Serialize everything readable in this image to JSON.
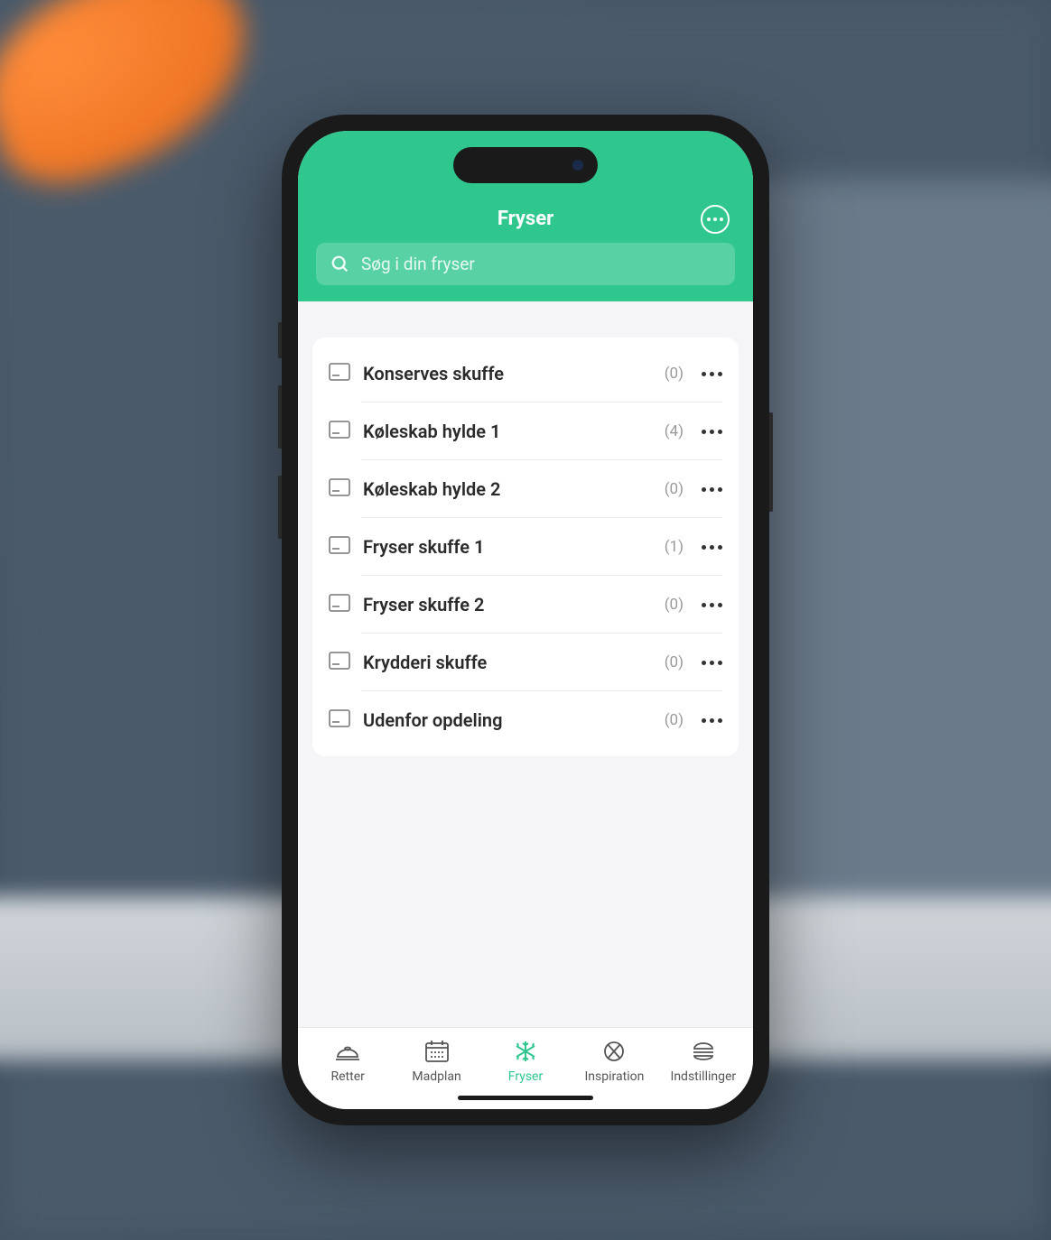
{
  "colors": {
    "accent": "#2fc78e",
    "text_dark": "#2a2a2a",
    "text_muted": "#999"
  },
  "header": {
    "title": "Fryser"
  },
  "search": {
    "placeholder": "Søg i din fryser"
  },
  "drawers": [
    {
      "label": "Konserves skuffe",
      "count": "(0)"
    },
    {
      "label": "Køleskab hylde 1",
      "count": "(4)"
    },
    {
      "label": "Køleskab hylde 2",
      "count": "(0)"
    },
    {
      "label": "Fryser skuffe 1",
      "count": "(1)"
    },
    {
      "label": "Fryser skuffe 2",
      "count": "(0)"
    },
    {
      "label": "Krydderi skuffe",
      "count": "(0)"
    },
    {
      "label": "Udenfor opdeling",
      "count": "(0)"
    }
  ],
  "tabs": [
    {
      "label": "Retter",
      "active": false,
      "icon": "dish"
    },
    {
      "label": "Madplan",
      "active": false,
      "icon": "calendar"
    },
    {
      "label": "Fryser",
      "active": true,
      "icon": "snowflake"
    },
    {
      "label": "Inspiration",
      "active": false,
      "icon": "utensils"
    },
    {
      "label": "Indstillinger",
      "active": false,
      "icon": "burger"
    }
  ]
}
